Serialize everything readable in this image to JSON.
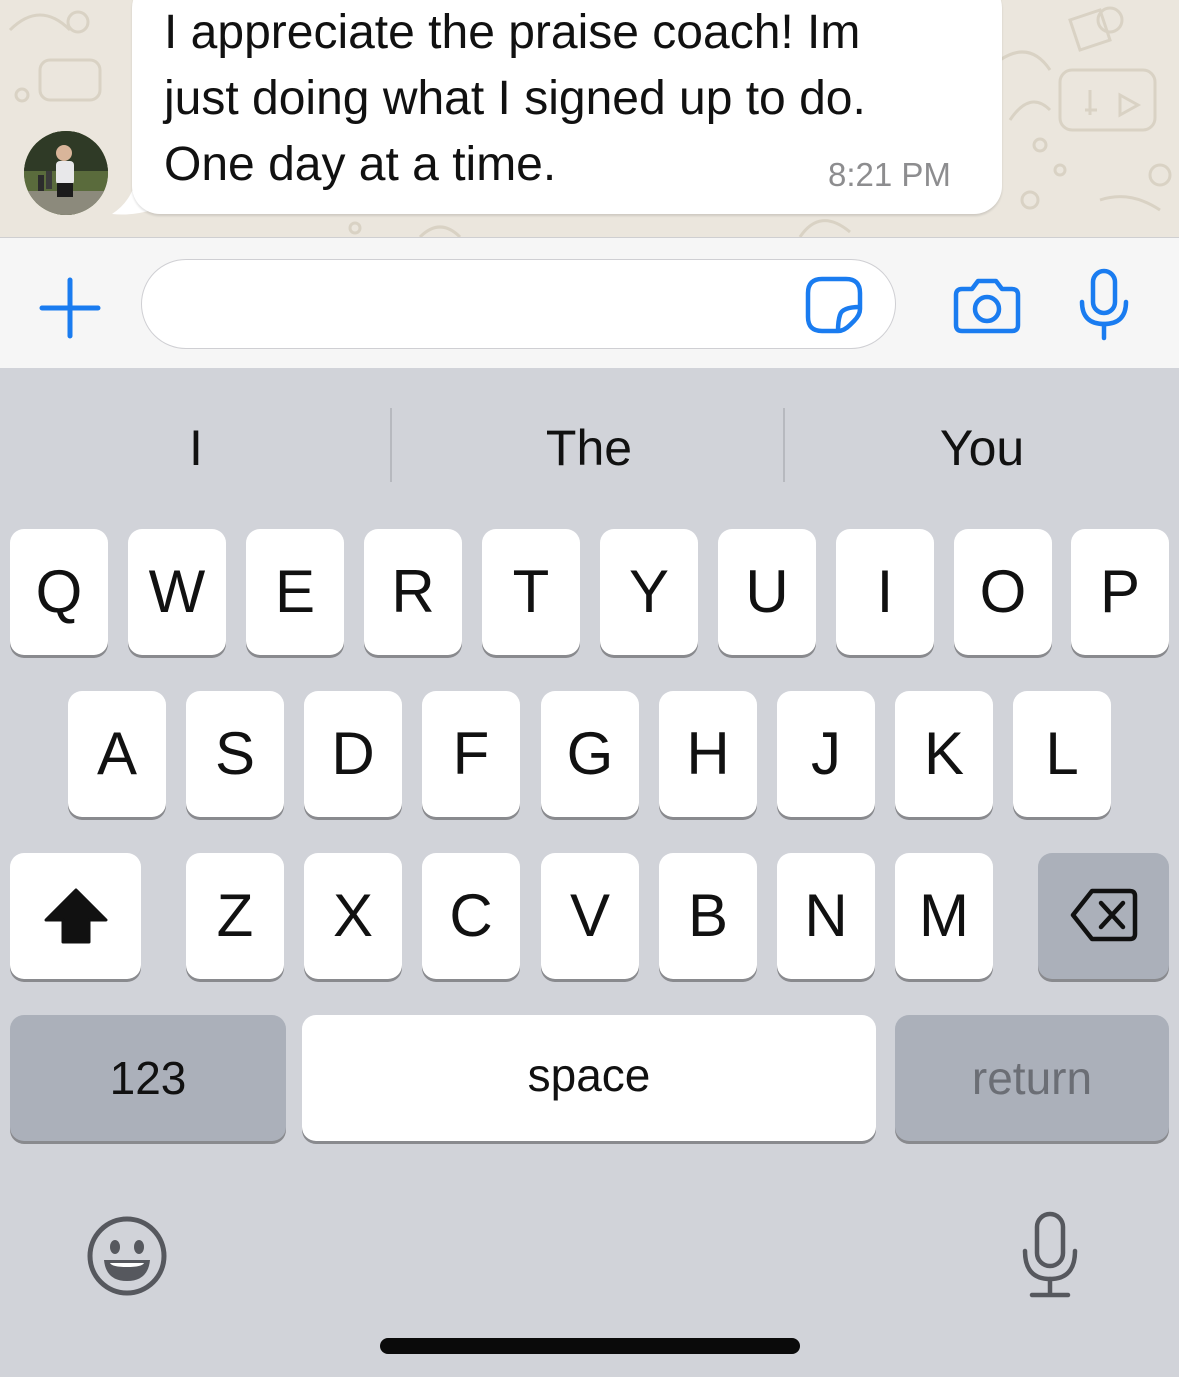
{
  "chat": {
    "message_text": "I appreciate the praise coach! Im\njust doing what I signed up to do.\nOne day at a time.",
    "message_time": "8:21 PM"
  },
  "input_bar": {
    "text_value": "",
    "icons": [
      "plus-icon",
      "sticker-icon",
      "camera-icon",
      "microphone-icon"
    ],
    "accent_color": "#1a7cf0"
  },
  "keyboard": {
    "suggestions": [
      "I",
      "The",
      "You"
    ],
    "row1": [
      "Q",
      "W",
      "E",
      "R",
      "T",
      "Y",
      "U",
      "I",
      "O",
      "P"
    ],
    "row2": [
      "A",
      "S",
      "D",
      "F",
      "G",
      "H",
      "J",
      "K",
      "L"
    ],
    "row3": [
      "Z",
      "X",
      "C",
      "V",
      "B",
      "N",
      "M"
    ],
    "numbers_label": "123",
    "space_label": "space",
    "return_label": "return",
    "icons": [
      "shift-icon",
      "backspace-icon",
      "emoji-icon",
      "dictation-icon"
    ]
  }
}
